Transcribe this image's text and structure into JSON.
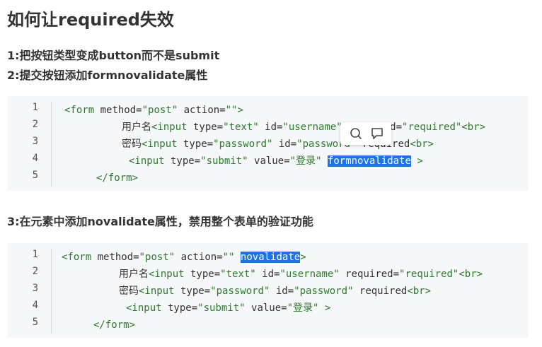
{
  "title": "如何让required失效",
  "steps": {
    "s1": "1:把按钮类型变成button而不是submit",
    "s2": "2:提交按钮添加formnovalidate属性",
    "s3": "3:在元素中添加novalidate属性，禁用整个表单的验证功能"
  },
  "block1": {
    "lines": [
      {
        "num": "1"
      },
      {
        "num": "2"
      },
      {
        "num": "3"
      },
      {
        "num": "4"
      },
      {
        "num": "5"
      }
    ]
  },
  "block2": {
    "lines": [
      {
        "num": "1"
      },
      {
        "num": "2"
      },
      {
        "num": "3"
      },
      {
        "num": "4"
      },
      {
        "num": "5"
      }
    ]
  },
  "code": {
    "form_open": "<form",
    "method_attr": " method=",
    "method_val": "\"post\"",
    "action_attr": " action=",
    "action_val": "\"\"",
    "gt": ">",
    "novalidate": "novalidate",
    "username_label": "用户名",
    "input_open": "<input",
    "type_attr": " type=",
    "text_val": "\"text\"",
    "id_attr": " id=",
    "username_val": "\"username\"",
    "required_attr": " required=",
    "required_val": "\"required\"",
    "br": "<br>",
    "password_label": "密码",
    "password_type": "\"password\"",
    "password_id": "\"password\"",
    "required_kw": " required",
    "submit_val": "\"submit\"",
    "value_attr": " value=",
    "login_val": "\"登录\"",
    "formnovalidate": "formnovalidate",
    "form_close": "</form>"
  },
  "toolbar": {
    "search_icon": "search-icon",
    "comment_icon": "comment-icon"
  }
}
